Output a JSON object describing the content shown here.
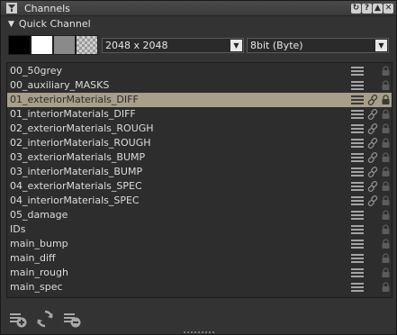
{
  "window": {
    "title": "Channels",
    "buttons": [
      "↻",
      "?",
      "▲",
      "✕"
    ]
  },
  "quick_channel": {
    "label": "Quick Channel",
    "swatches": [
      {
        "name": "black",
        "color": "#000000"
      },
      {
        "name": "white",
        "color": "#ffffff"
      },
      {
        "name": "grey",
        "color": "#8a8a8a"
      },
      {
        "name": "checker",
        "color": "#bdbdbd"
      }
    ],
    "size_value": "2048 x 2048",
    "depth_value": "8bit  (Byte)"
  },
  "channels": [
    {
      "name": "00_50grey",
      "linked": false,
      "selected": false
    },
    {
      "name": "00_auxiliary_MASKS",
      "linked": false,
      "selected": false
    },
    {
      "name": "01_exteriorMaterials_DIFF",
      "linked": true,
      "selected": true
    },
    {
      "name": "01_interiorMaterials_DIFF",
      "linked": true,
      "selected": false
    },
    {
      "name": "02_exteriorMaterials_ROUGH",
      "linked": true,
      "selected": false
    },
    {
      "name": "02_interiorMaterials_ROUGH",
      "linked": true,
      "selected": false
    },
    {
      "name": "03_exteriorMaterials_BUMP",
      "linked": true,
      "selected": false
    },
    {
      "name": "03_interiorMaterials_BUMP",
      "linked": true,
      "selected": false
    },
    {
      "name": "04_exteriorMaterials_SPEC",
      "linked": true,
      "selected": false
    },
    {
      "name": "04_interiorMaterials_SPEC",
      "linked": true,
      "selected": false
    },
    {
      "name": "05_damage",
      "linked": false,
      "selected": false
    },
    {
      "name": "IDs",
      "linked": false,
      "selected": false
    },
    {
      "name": "main_bump",
      "linked": false,
      "selected": false
    },
    {
      "name": "main_diff",
      "linked": false,
      "selected": false
    },
    {
      "name": "main_rough",
      "linked": false,
      "selected": false
    },
    {
      "name": "main_spec",
      "linked": false,
      "selected": false
    }
  ],
  "toolbar": {
    "buttons": [
      {
        "icon": "add-channel-icon"
      },
      {
        "icon": "refresh-icon"
      },
      {
        "icon": "remove-channel-icon"
      }
    ]
  },
  "colors": {
    "selected_row": "#a79f89",
    "panel_bg": "#333333",
    "list_bg": "#2d2d2d"
  }
}
